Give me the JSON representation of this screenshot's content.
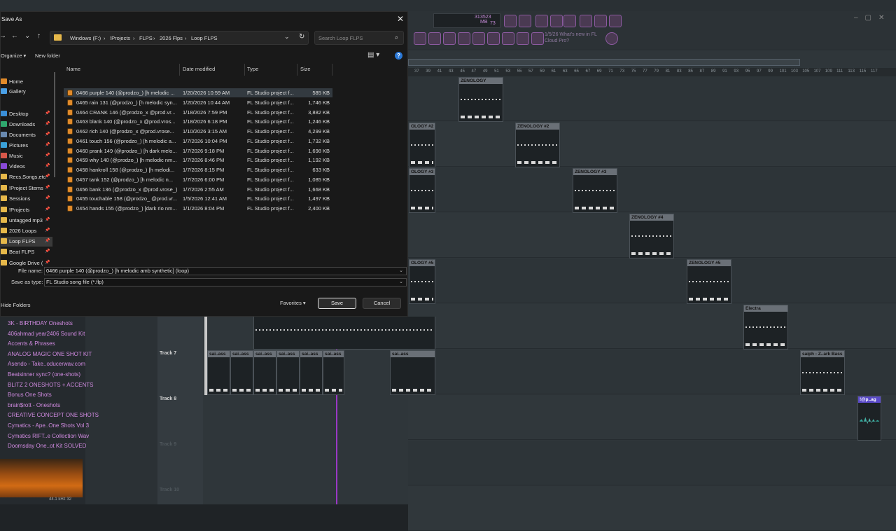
{
  "dialog": {
    "title": "Save As",
    "close_glyph": "✕",
    "nav": {
      "back": "←",
      "forward": "→",
      "recent": "⌄",
      "up": "↑"
    },
    "breadcrumb": [
      "Windows (F:)",
      "!Projects",
      "FLPS",
      "2026 Flps",
      "Loop FLPS"
    ],
    "breadcrumb_sep": "›",
    "search_placeholder": "Search Loop FLPS",
    "organize": "Organize",
    "new_folder": "New folder",
    "sidebar": [
      {
        "label": "Home",
        "icon": "home-icon",
        "color": "#e08a2a",
        "pinned": false,
        "selected": false
      },
      {
        "label": "Gallery",
        "icon": "gallery-icon",
        "color": "#4aa0e6",
        "pinned": false,
        "selected": false
      },
      {
        "label": "Desktop",
        "icon": "desktop-icon",
        "color": "#3a8fd8",
        "pinned": true,
        "selected": false
      },
      {
        "label": "Downloads",
        "icon": "downloads-icon",
        "color": "#2fa76e",
        "pinned": true,
        "selected": false
      },
      {
        "label": "Documents",
        "icon": "documents-icon",
        "color": "#6a8ab0",
        "pinned": true,
        "selected": false
      },
      {
        "label": "Pictures",
        "icon": "pictures-icon",
        "color": "#3aa0d8",
        "pinned": true,
        "selected": false
      },
      {
        "label": "Music",
        "icon": "music-icon",
        "color": "#d8584a",
        "pinned": true,
        "selected": false
      },
      {
        "label": "Videos",
        "icon": "videos-icon",
        "color": "#8a4ad8",
        "pinned": true,
        "selected": false
      },
      {
        "label": "Recs,Songs,etc",
        "icon": "folder-icon",
        "color": "#e6b84a",
        "pinned": true,
        "selected": false
      },
      {
        "label": "!Project Stems",
        "icon": "folder-icon",
        "color": "#e6b84a",
        "pinned": true,
        "selected": false
      },
      {
        "label": "Sessions",
        "icon": "folder-icon",
        "color": "#e6b84a",
        "pinned": true,
        "selected": false
      },
      {
        "label": "!Projects",
        "icon": "folder-icon",
        "color": "#e6b84a",
        "pinned": true,
        "selected": false
      },
      {
        "label": "untagged mp3",
        "icon": "folder-icon",
        "color": "#e6b84a",
        "pinned": true,
        "selected": false
      },
      {
        "label": "2026 Loops",
        "icon": "folder-icon",
        "color": "#e6b84a",
        "pinned": true,
        "selected": false
      },
      {
        "label": "Loop FLPS",
        "icon": "folder-icon",
        "color": "#e6b84a",
        "pinned": true,
        "selected": true
      },
      {
        "label": "Beat FLPS",
        "icon": "folder-icon",
        "color": "#e6b84a",
        "pinned": true,
        "selected": false
      },
      {
        "label": "Google Drive (",
        "icon": "google-drive-icon",
        "color": "#e6b84a",
        "pinned": true,
        "selected": false
      }
    ],
    "pin_glyph": "📌",
    "columns": [
      "Name",
      "Date modified",
      "Type",
      "Size"
    ],
    "files": [
      {
        "name": "0466 purple 140 (@prodzo_) [h melodic ...",
        "date": "1/20/2026 10:59 AM",
        "type": "FL Studio project f...",
        "size": "585 KB",
        "selected": true
      },
      {
        "name": "0465 rain 131 (@prodzo_) [h melodic syn...",
        "date": "1/20/2026 10:44 AM",
        "type": "FL Studio project f...",
        "size": "1,746 KB",
        "selected": false
      },
      {
        "name": "0464 CRANK 146 (@prodzo_x @prod.vr...",
        "date": "1/18/2026 7:59 PM",
        "type": "FL Studio project f...",
        "size": "3,882 KB",
        "selected": false
      },
      {
        "name": "0463 blank 140 (@prodzo_x @prod.vros...",
        "date": "1/18/2026 6:18 PM",
        "type": "FL Studio project f...",
        "size": "1,246 KB",
        "selected": false
      },
      {
        "name": "0462 rich 140 (@prodzo_x @prod.vrose...",
        "date": "1/10/2026 3:15 AM",
        "type": "FL Studio project f...",
        "size": "4,299 KB",
        "selected": false
      },
      {
        "name": "0461 touch 156 (@prodzo_) [h melodic a...",
        "date": "1/7/2026 10:04 PM",
        "type": "FL Studio project f...",
        "size": "1,732 KB",
        "selected": false
      },
      {
        "name": "0460 prank 149 (@prodzo_) [h dark melo...",
        "date": "1/7/2026 9:18 PM",
        "type": "FL Studio project f...",
        "size": "1,698 KB",
        "selected": false
      },
      {
        "name": "0459 why 140 (@prodzo_) [h melodic nm...",
        "date": "1/7/2026 8:46 PM",
        "type": "FL Studio project f...",
        "size": "1,192 KB",
        "selected": false
      },
      {
        "name": "0458 hankroll 158 (@prodzo_) [h melodi...",
        "date": "1/7/2026 8:15 PM",
        "type": "FL Studio project f...",
        "size": "633 KB",
        "selected": false
      },
      {
        "name": "0457 tank 152 (@prodzo_) [h melodic n...",
        "date": "1/7/2026 6:00 PM",
        "type": "FL Studio project f...",
        "size": "1,085 KB",
        "selected": false
      },
      {
        "name": "0456 bank 136 (@prodzo_x @prod.vrose_)...",
        "date": "1/7/2026 2:55 AM",
        "type": "FL Studio project f...",
        "size": "1,668 KB",
        "selected": false
      },
      {
        "name": "0455 touchable 158 (@prodzo_ @prod.vr...",
        "date": "1/5/2026 12:41 AM",
        "type": "FL Studio project f...",
        "size": "1,497 KB",
        "selected": false
      },
      {
        "name": "0454 hands 155 (@prodzo_) [dark rio nm...",
        "date": "1/1/2026 8:04 PM",
        "type": "FL Studio project f...",
        "size": "2,400 KB",
        "selected": false
      }
    ],
    "file_name_label": "File name:",
    "file_name_value": "0466 purple 140 (@prodzo_) [h melodic amb synthetic] (loop)",
    "save_type_label": "Save as type:",
    "save_type_value": "FL Studio song file (*.flp)",
    "hide_folders": "Hide Folders",
    "favorites": "Favorites",
    "save": "Save",
    "cancel": "Cancel",
    "dropdown_glyph": "⌄"
  },
  "fl": {
    "cpu_line1": "31",
    "cpu_mem": "3523 MB",
    "cpu_line2": "73",
    "hint_line1": "1/5/26 What's new in FL",
    "hint_line2": "Cloud Pro?",
    "accent": "#c44fe0",
    "ruler_ticks": [
      "37",
      "39",
      "41",
      "43",
      "45",
      "47",
      "49",
      "51",
      "53",
      "55",
      "57",
      "59",
      "61",
      "63",
      "65",
      "67",
      "69",
      "71",
      "73",
      "75",
      "77",
      "79",
      "81",
      "83",
      "85",
      "87",
      "89",
      "91",
      "93",
      "95",
      "97",
      "99",
      "101",
      "103",
      "105",
      "107",
      "109",
      "111",
      "113",
      "115",
      "117"
    ],
    "clips": [
      {
        "label": "ZENOLOGY"
      },
      {
        "label": "OLOGY #2"
      },
      {
        "label": "ZENOLOGY #2"
      },
      {
        "label": "OLOGY #3"
      },
      {
        "label": "ZENOLOGY #3"
      },
      {
        "label": "ZENOLOGY #4"
      },
      {
        "label": "OLOGY #5"
      },
      {
        "label": "ZENOLOGY #5"
      },
      {
        "label": "Electra"
      },
      {
        "label": "saiph - Z..ark Bass"
      },
      {
        "label": "!@p..ag"
      }
    ],
    "track_labels": [
      "Track 7",
      "Track 8",
      "Track 9",
      "Track 10"
    ],
    "track7_clip_label": "sai..ass",
    "browser_items": [
      "3K - BIRTHDAY Oneshots",
      "406ahmad year2406 Sound Kit",
      "Accents & Phrases",
      "ANALOG MAGIC ONE SHOT KIT",
      "Asendo - Take..oducerwav.com",
      "Beatsinner sync? (one-shots)",
      "BLITZ 2 ONESHOTS + ACCENTS",
      "Bonus One Shots",
      "brain$rott - Oneshots",
      "CREATIVE CONCEPT ONE SHOTS",
      "Cymatics - Ape..One Shots Vol 3",
      "Cymatics RIFT..e Collection Wav",
      "Doomsday One..ot Kit SOLVED"
    ],
    "browser_status": "44.1 kHz 32"
  }
}
